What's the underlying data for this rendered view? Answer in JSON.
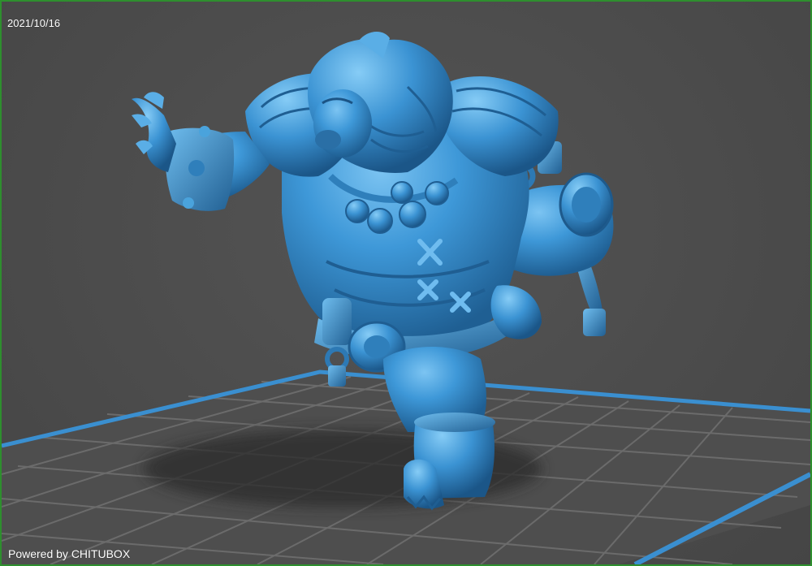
{
  "viewport": {
    "date": "2021/10/16",
    "credit": "Powered by CHITUBOX"
  },
  "colors": {
    "background": "#4b4b4b",
    "grid_line": "#6a6a6a",
    "platform_edge": "#3a8fd0",
    "model": "#3c95d4",
    "window_border": "#2e8f2e"
  },
  "model": {
    "icon": "lion-warrior-miniature-icon"
  }
}
